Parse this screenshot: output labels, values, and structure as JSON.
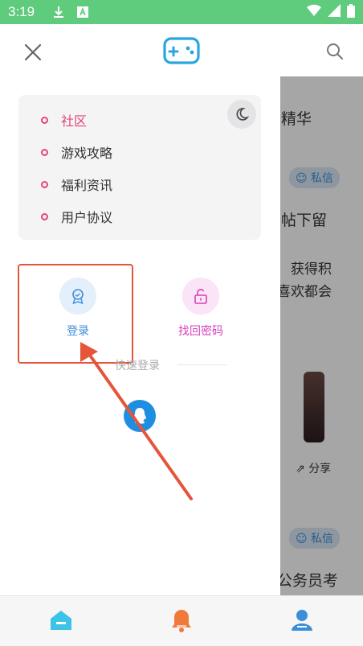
{
  "status_bar": {
    "time": "3:19",
    "icons": [
      "download-icon",
      "a-badge-icon",
      "wifi-icon",
      "signal-icon",
      "battery-icon"
    ],
    "color": "#5fcc7d"
  },
  "header": {
    "close_icon": "close-icon",
    "logo_icon": "gamepad-icon",
    "search_icon": "search-icon"
  },
  "menu": {
    "items": [
      {
        "label": "社区",
        "active": true
      },
      {
        "label": "游戏攻略",
        "active": false
      },
      {
        "label": "福利资讯",
        "active": false
      },
      {
        "label": "用户协议",
        "active": false
      }
    ],
    "night_mode_icon": "moon-icon",
    "accent": "#e0457b"
  },
  "actions": {
    "login": {
      "label": "登录",
      "color": "#3b8fd8"
    },
    "recover": {
      "label": "找回密码",
      "color": "#d63fbd"
    }
  },
  "quick_login": {
    "label": "快速登录",
    "qq_icon": "qq-icon"
  },
  "background_page": {
    "texts": [
      "精华",
      "帖下留",
      "获得积",
      "喜欢都会",
      "公务员考"
    ],
    "chips": [
      "私信",
      "私信"
    ],
    "share": "分享"
  },
  "bottom_nav": {
    "tabs": [
      {
        "name": "home",
        "icon": "home-icon",
        "color": "#3ec3e8"
      },
      {
        "name": "messages",
        "icon": "bell-icon",
        "color": "#f07a3a"
      },
      {
        "name": "profile",
        "icon": "user-icon",
        "color": "#3b8fd8"
      }
    ]
  }
}
